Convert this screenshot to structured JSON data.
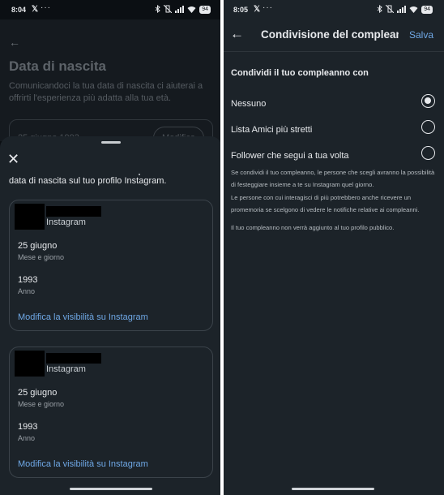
{
  "left": {
    "status": {
      "time": "8:04",
      "x_logo": "𝕏",
      "dots": "···",
      "battery": "94"
    },
    "background": {
      "back_icon": "←",
      "title": "Data di nascita",
      "description": "Comunicandoci la tua data di nascita ci aiuterai a offrirti l'esperienza più adatta alla tua età.",
      "field_value": "25 giugno 1993",
      "field_button": "Modifica"
    },
    "sheet": {
      "close_icon": "✕",
      "intro": "data di nascita sul tuo profilo Instagram.",
      "cards": [
        {
          "app": "Instagram",
          "date": "25 giugno",
          "date_label": "Mese e giorno",
          "year": "1993",
          "year_label": "Anno",
          "link": "Modifica la visibilità su Instagram"
        },
        {
          "app": "Instagram",
          "date": "25 giugno",
          "date_label": "Mese e giorno",
          "year": "1993",
          "year_label": "Anno",
          "link": "Modifica la visibilità su Instagram"
        }
      ]
    }
  },
  "right": {
    "status": {
      "time": "8:05",
      "x_logo": "𝕏",
      "dots": "···",
      "battery": "94"
    },
    "topbar": {
      "back_icon": "←",
      "title": "Condivisione del compleanno",
      "save": "Salva"
    },
    "heading": "Condividi il tuo compleanno con",
    "options": [
      {
        "label": "Nessuno",
        "selected": true
      },
      {
        "label": "Lista Amici più stretti",
        "selected": false
      },
      {
        "label": "Follower che segui a tua volta",
        "selected": false
      }
    ],
    "info": [
      "Se condividi il tuo compleanno, le persone che scegli avranno la possibilità di festeggiare insieme a te su Instagram quel giorno.",
      "Le persone con cui interagisci di più potrebbero anche ricevere un promemoria se scelgono di vedere le notifiche relative ai compleanni.",
      "Il tuo compleanno non verrà aggiunto al tuo profilo pubblico."
    ]
  },
  "colors": {
    "accent": "#6fa8e6",
    "background": "#1c2329",
    "text": "#e8eaed"
  }
}
